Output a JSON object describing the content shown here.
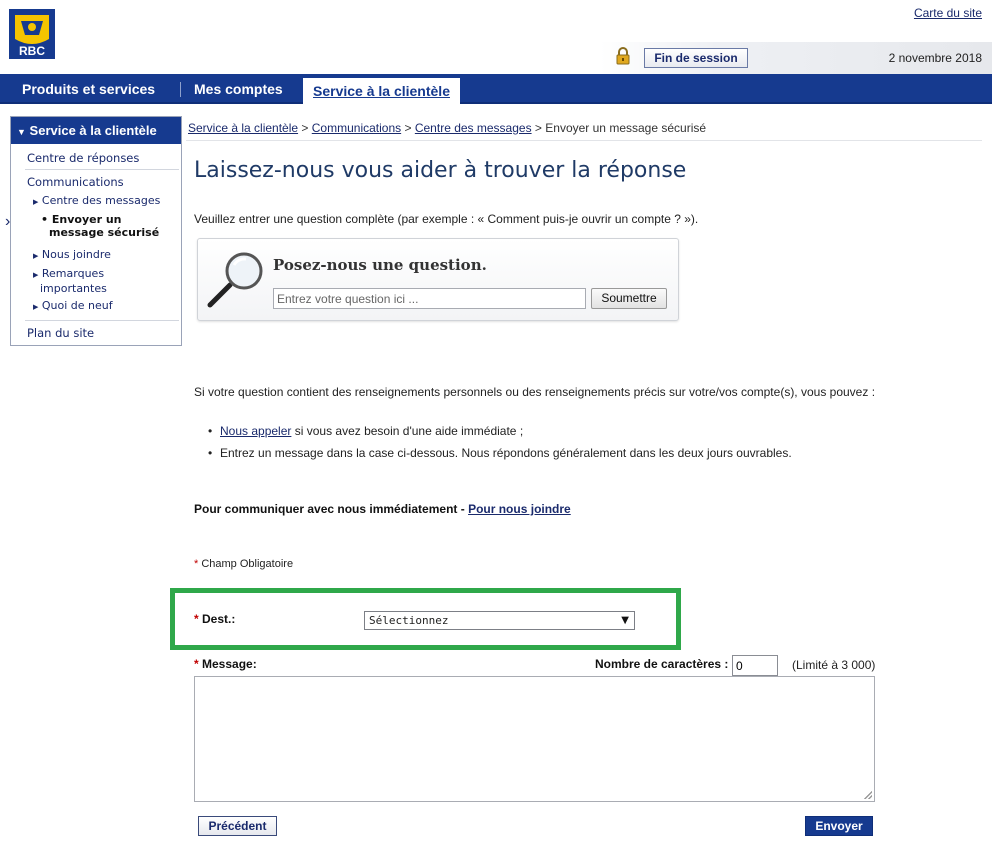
{
  "header": {
    "logo_text": "RBC",
    "sitemap_link": "Carte du site",
    "logout_button": "Fin de session",
    "date": "2 novembre 2018"
  },
  "nav": {
    "items": [
      {
        "label": "Produits et services"
      },
      {
        "label": "Mes comptes"
      },
      {
        "label": "Service à la clientèle"
      }
    ]
  },
  "sidebar": {
    "header": "Service à la clientèle",
    "items": {
      "faq": "Centre de réponses",
      "communications": "Communications",
      "messages_center": "Centre des messages",
      "send_secure_1": "Envoyer un",
      "send_secure_2": "message sécurisé",
      "contact": "Nous joindre",
      "notes_1": "Remarques",
      "notes_2": "importantes",
      "whats_new": "Quoi de neuf",
      "sitemap": "Plan du site"
    }
  },
  "breadcrumb": {
    "items": [
      "Service à la clientèle",
      "Communications",
      "Centre des messages"
    ],
    "separator": ">",
    "current": "Envoyer un message sécurisé"
  },
  "main": {
    "title": "Laissez-nous vous aider à trouver la réponse",
    "intro": "Veuillez entrer une question complète (par exemple : « Comment puis-je ouvrir un compte ? »).",
    "question_box": {
      "title": "Posez-nous une question.",
      "placeholder": "Entrez votre question ici ...",
      "submit": "Soumettre"
    },
    "personal_info_text": "Si votre question contient des renseignements personnels ou des renseignements précis sur votre/vos compte(s), vous pouvez :",
    "bullets": {
      "call_link": "Nous appeler",
      "call_rest": " si vous avez besoin d'une aide immédiate ;",
      "message": "Entrez un message dans la case ci-dessous. Nous répondons généralement dans les deux jours ouvrables."
    },
    "contact_now": "Pour communiquer avec nous immédiatement - ",
    "contact_link": "Pour nous joindre",
    "required_note": "Champ Obligatoire",
    "required_star": "*"
  },
  "form": {
    "dest_label": "Dest.:",
    "dest_selected": "Sélectionnez",
    "message_label": "Message:",
    "char_count_label": "Nombre de caractères :",
    "char_count_value": "0",
    "limit_text": "(Limité à 3 000)",
    "message_value": "",
    "prev_button": "Précédent",
    "send_button": "Envoyer"
  },
  "colors": {
    "brand_blue": "#163a8f",
    "highlight_green": "#2fa84a",
    "required_red": "#c00000"
  }
}
